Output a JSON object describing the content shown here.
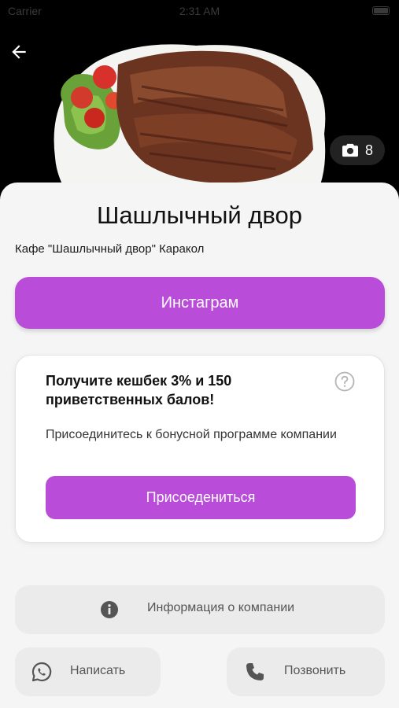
{
  "status_bar": {
    "carrier": "Carrier",
    "time": "2:31 AM"
  },
  "hero": {
    "photo_count": "8"
  },
  "venue": {
    "title": "Шашлычный двор",
    "subtitle": "Кафе \"Шашлычный двор\" Каракол"
  },
  "actions": {
    "instagram_label": "Инстаграм",
    "info_label": "Информация о компании",
    "write_label": "Написать",
    "call_label": "Позвонить"
  },
  "bonus": {
    "title": "Получите кешбек 3% и 150 приветственных балов!",
    "description": "Присоединитесь к бонусной программе компании",
    "join_label": "Присоедениться"
  },
  "colors": {
    "accent": "#b94cd9",
    "sheet_background": "#f5f5f5",
    "secondary_button": "#ebebeb"
  },
  "icons": {
    "back": "arrow-left-icon",
    "photos": "camera-icon",
    "help": "question-circle-icon",
    "info": "info-circle-icon",
    "write": "whatsapp-icon",
    "call": "phone-icon"
  }
}
